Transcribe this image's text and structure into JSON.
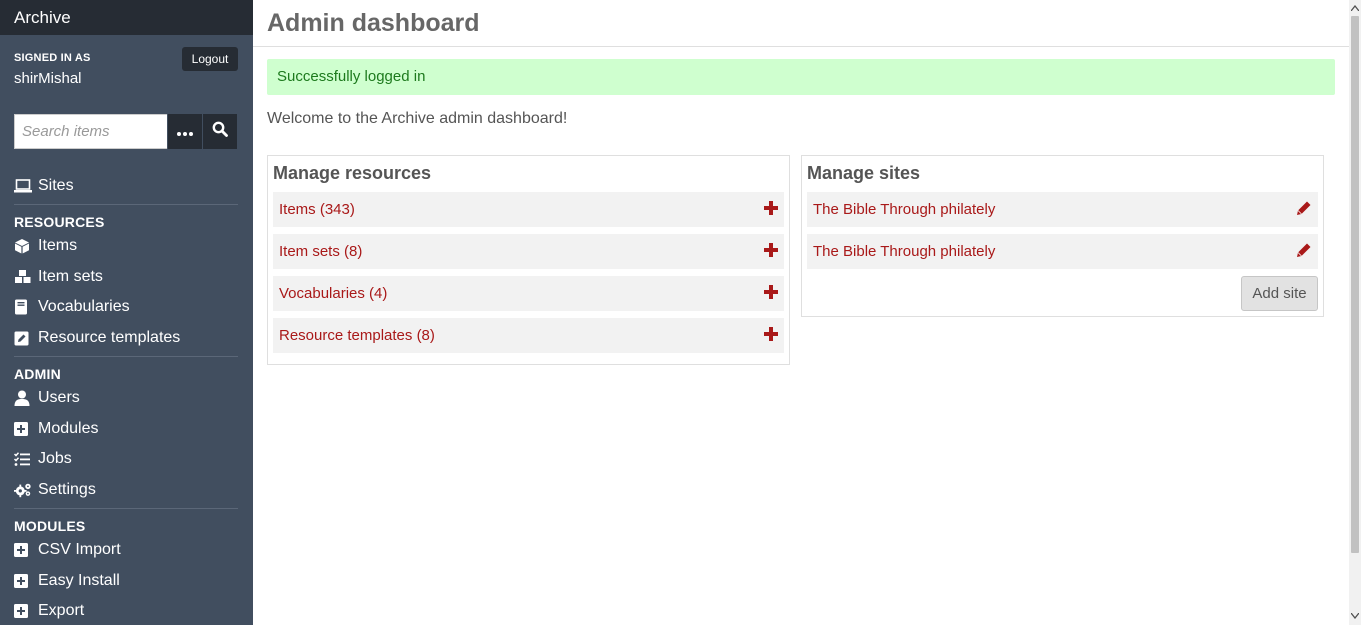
{
  "sidebar": {
    "brand": "Archive",
    "signed_in_label": "SIGNED IN AS",
    "username": "shirMishal",
    "logout_label": "Logout",
    "search_placeholder": "Search items",
    "sites_label": "Sites",
    "resources_heading": "RESOURCES",
    "resources": [
      {
        "label": "Items",
        "icon": "cube-icon"
      },
      {
        "label": "Item sets",
        "icon": "cubes-icon"
      },
      {
        "label": "Vocabularies",
        "icon": "book-icon"
      },
      {
        "label": "Resource templates",
        "icon": "edit-icon"
      }
    ],
    "admin_heading": "ADMIN",
    "admin": [
      {
        "label": "Users",
        "icon": "user-icon"
      },
      {
        "label": "Modules",
        "icon": "plus-square-icon"
      },
      {
        "label": "Jobs",
        "icon": "tasks-icon"
      },
      {
        "label": "Settings",
        "icon": "cogs-icon"
      }
    ],
    "modules_heading": "MODULES",
    "modules": [
      {
        "label": "CSV Import",
        "icon": "plus-square-icon"
      },
      {
        "label": "Easy Install",
        "icon": "plus-square-icon"
      },
      {
        "label": "Export",
        "icon": "plus-square-icon"
      }
    ]
  },
  "main": {
    "title": "Admin dashboard",
    "flash": "Successfully logged in",
    "welcome": "Welcome to the Archive admin dashboard!",
    "resources_panel": {
      "title": "Manage resources",
      "rows": [
        "Items (343)",
        "Item sets (8)",
        "Vocabularies (4)",
        "Resource templates (8)"
      ]
    },
    "sites_panel": {
      "title": "Manage sites",
      "rows": [
        "The Bible Through philately",
        "The Bible Through philately"
      ],
      "add_label": "Add site"
    }
  },
  "colors": {
    "sidebar_bg": "#414e5f",
    "brand_bg": "#262c34",
    "accent": "#a91919",
    "flash_bg": "#cfffcf",
    "flash_text": "#1d7a1d"
  }
}
